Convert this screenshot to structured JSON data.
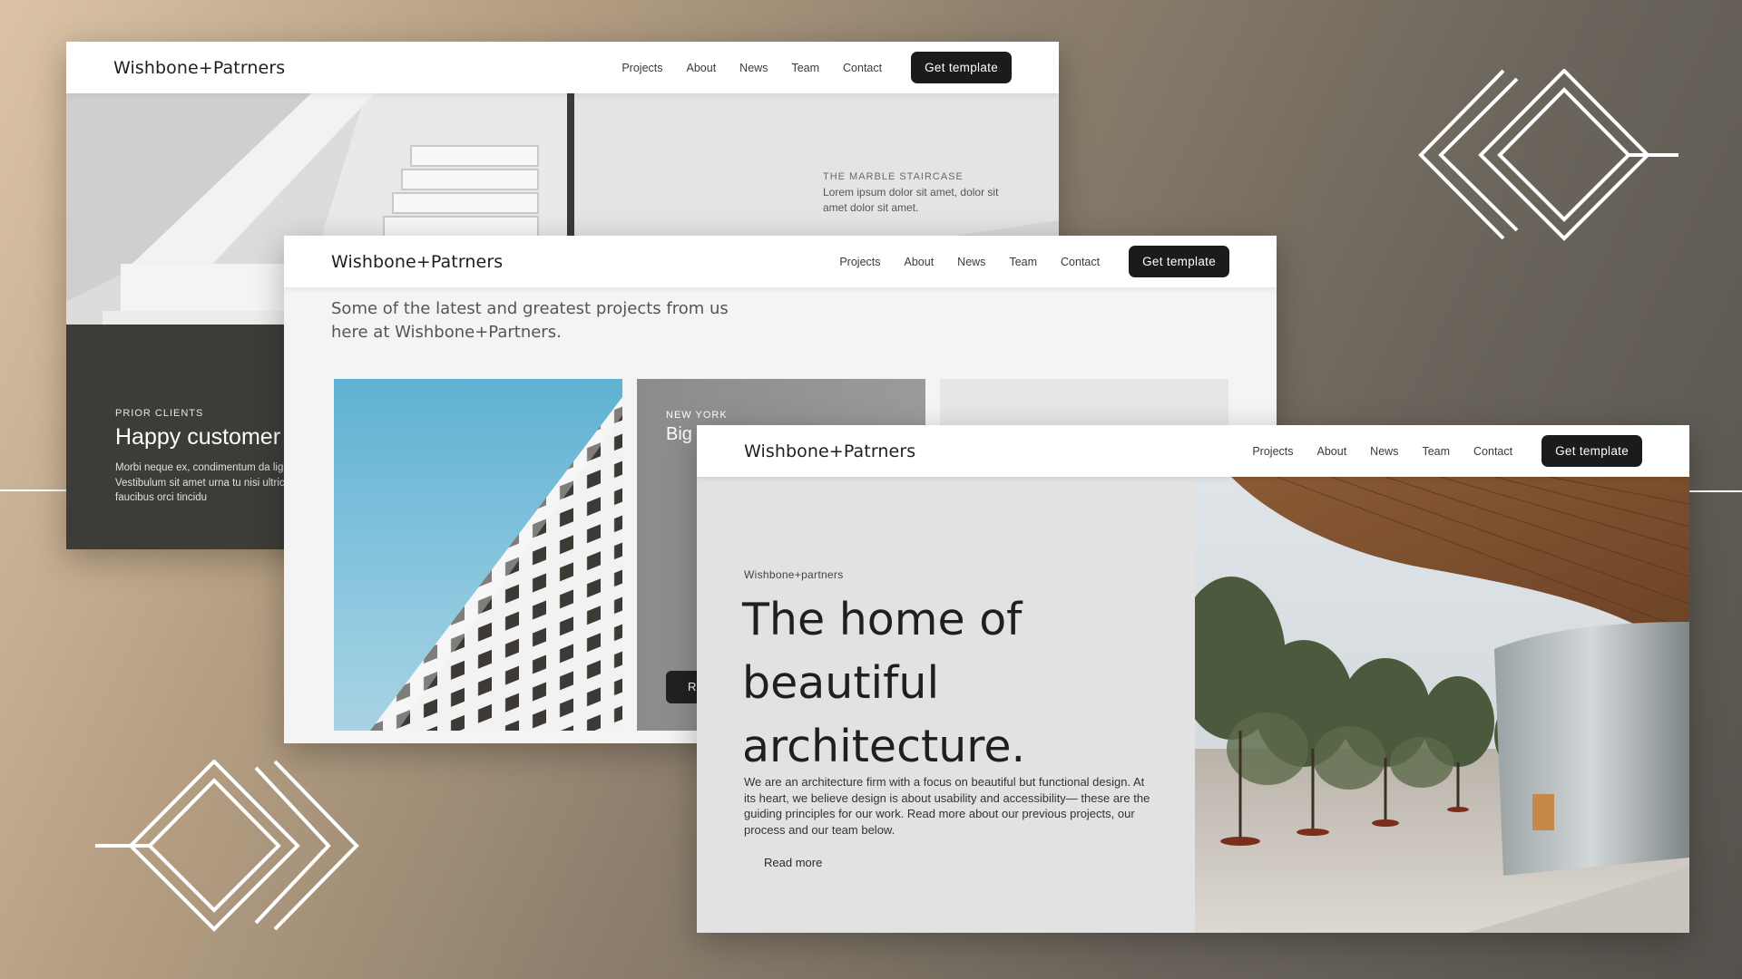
{
  "brand": "Wishbone+Patrners",
  "nav": {
    "items": [
      "Projects",
      "About",
      "News",
      "Team",
      "Contact"
    ],
    "cta": "Get template"
  },
  "window_back": {
    "caption_title": "THE MARBLE STAIRCASE",
    "caption_text": "Lorem ipsum dolor sit amet, dolor sit amet dolor sit amet.",
    "clients_kicker": "PRIOR CLIENTS",
    "clients_heading": "Happy customer",
    "clients_body": "Morbi neque ex, condimentum da ligula. Vestibulum sit amet urna tu nisi ultrices, ut faucibus orci tincidu"
  },
  "window_middle": {
    "intro": "Some of the latest and greatest projects from us here at Wishbone+Partners.",
    "card2_kicker": "NEW YORK",
    "card2_title": "Big",
    "card2_button": "R"
  },
  "window_front": {
    "small_brand": "Wishbone+partners",
    "hero_title": "The home of beautiful architecture.",
    "hero_text": "We are an architecture firm with a focus on beautiful but functional design. At its heart, we believe design is about usability and accessibility— these are the guiding principles for our work. Read more about our previous projects, our process and our team below.",
    "read_more": "Read more"
  },
  "colors": {
    "cta_bg": "#1b1b1b",
    "dark_panel": "#3d3c39",
    "deco_line": "#ffffff"
  }
}
